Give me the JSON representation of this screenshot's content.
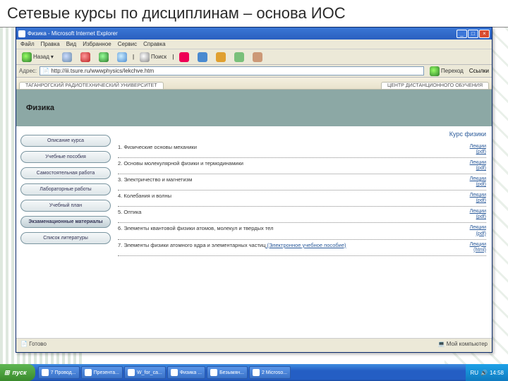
{
  "slide": {
    "title": "Сетевые курсы по дисциплинам – основа ИОС"
  },
  "browser": {
    "title": "Физика - Microsoft Internet Explorer",
    "menu": [
      "Файл",
      "Правка",
      "Вид",
      "Избранное",
      "Сервис",
      "Справка"
    ],
    "toolbar": {
      "back": "Назад",
      "search": "Поиск"
    },
    "addr_label": "Адрес:",
    "url": "http://iii.tsure.ru/wwwphysics/lekchve.htm",
    "go": "Переход",
    "links_label": "Ссылки",
    "status_left": "Готово",
    "status_right": "Мой компьютер"
  },
  "page": {
    "header_tabs": [
      "ТАГАНРОГСКИЙ РАДИОТЕХНИЧЕСКИЙ УНИВЕРСИТЕТ",
      "ЦЕНТР ДИСТАНЦИОННОГО ОБУЧЕНИЯ"
    ],
    "banner": "Физика",
    "nav": [
      "Описание курса",
      "Учебные пособия",
      "Самостоятельная работа",
      "Лабораторные работы",
      "Учебный план",
      "Экзаменационные материалы",
      "Список литературы"
    ],
    "main_title": "Курс физики",
    "link_lectures": "Лекции",
    "link_pdf": "(pdf)",
    "link_html": "(html)",
    "topics": [
      {
        "name": "1. Физические основы механики",
        "links": [
          "lectures",
          "pdf"
        ]
      },
      {
        "name": "2. Основы молекулярной физики и термодинамики",
        "links": [
          "lectures",
          "pdf"
        ]
      },
      {
        "name": "3. Электричество и магнетизм",
        "links": [
          "lectures",
          "pdf"
        ]
      },
      {
        "name": "4. Колебания и волны",
        "links": [
          "lectures",
          "pdf"
        ]
      },
      {
        "name": "5. Оптика",
        "links": [
          "lectures",
          "pdf"
        ]
      },
      {
        "name": "6. Элементы квантовой физики атомов, молекул и твердых тел",
        "links": [
          "lectures",
          "pdf"
        ]
      },
      {
        "name": "7. Элементы физики атомного ядра и элементарных частиц",
        "extra": "(Электронное учебное пособие)",
        "links": [
          "lectures",
          "html"
        ]
      }
    ]
  },
  "taskbar": {
    "start": "пуск",
    "lang": "RU",
    "time": "14:58",
    "items": [
      "7 Провод...",
      "Презента...",
      "W_for_ca...",
      "Физика ...",
      "Безымян...",
      "2 Microso..."
    ]
  }
}
